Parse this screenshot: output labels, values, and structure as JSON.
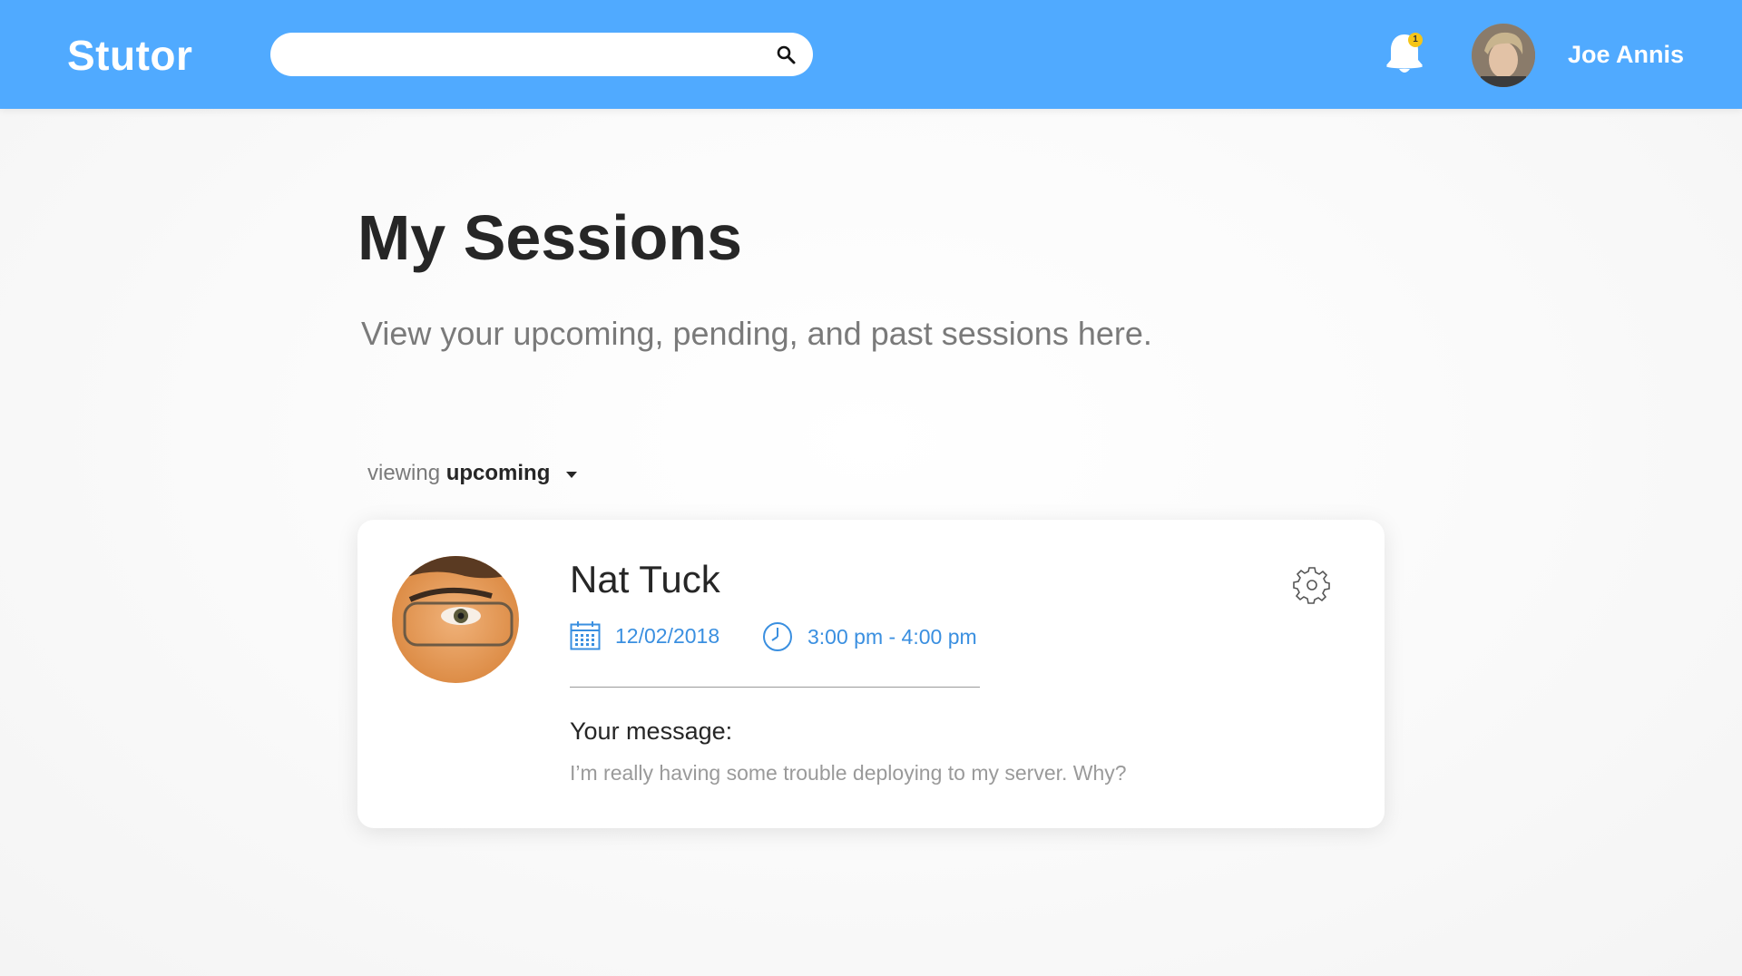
{
  "header": {
    "brand": "Stutor",
    "search": {
      "value": "",
      "placeholder": ""
    },
    "notifications": {
      "count": "1"
    },
    "user": {
      "name": "Joe Annis"
    }
  },
  "page": {
    "title": "My Sessions",
    "subtitle": "View your upcoming, pending, and past sessions here.",
    "filter": {
      "prefix": "viewing",
      "selected": "upcoming"
    }
  },
  "session": {
    "tutor_name": "Nat Tuck",
    "date": "12/02/2018",
    "time": "3:00 pm - 4:00 pm",
    "message_label": "Your message:",
    "message": "I’m really having some trouble deploying to my server. Why?"
  },
  "icons": {
    "search": "search-icon",
    "bell": "bell-icon",
    "caret": "caret-down-icon",
    "calendar": "calendar-icon",
    "clock": "clock-icon",
    "gear": "gear-icon"
  },
  "colors": {
    "header": "#50aaff",
    "accent": "#3a8fe0",
    "badge": "#f5c518"
  }
}
